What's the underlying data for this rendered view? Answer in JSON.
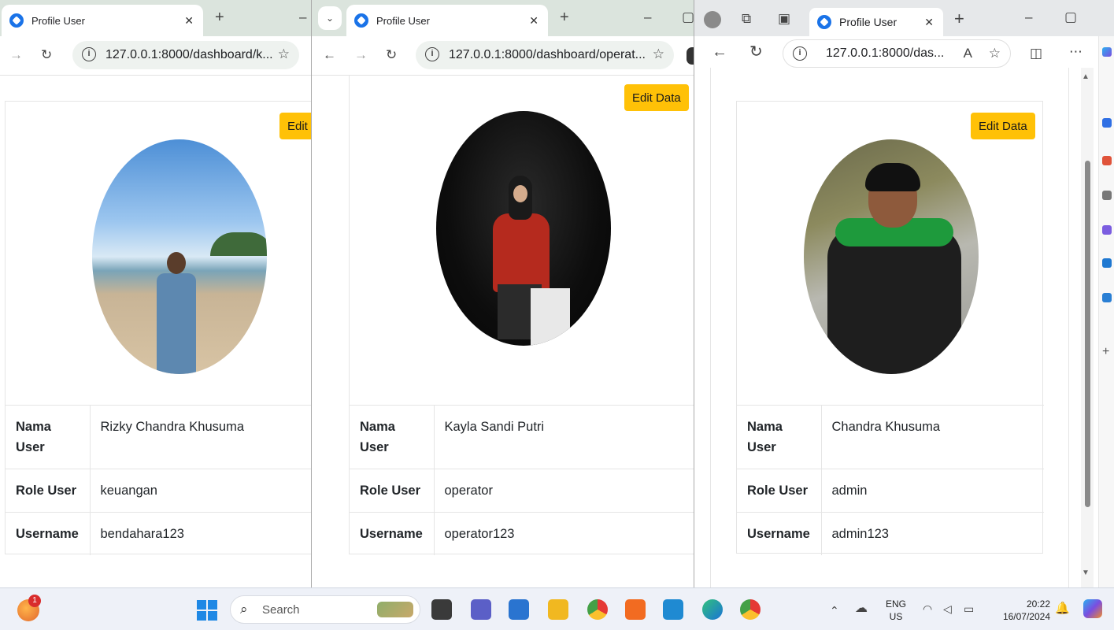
{
  "windows": [
    {
      "tab_title": "Profile User",
      "url": "127.0.0.1:8000/dashboard/k...",
      "edit_label": "Edit",
      "profile": {
        "name_label": "Nama User",
        "name": "Rizky Chandra Khusuma",
        "role_label": "Role User",
        "role": "keuangan",
        "username_label": "Username",
        "username": "bendahara123"
      }
    },
    {
      "tab_title": "Profile User",
      "url": "127.0.0.1:8000/dashboard/operat...",
      "edit_label": "Edit Data",
      "profile": {
        "name_label": "Nama User",
        "name": "Kayla Sandi Putri",
        "role_label": "Role User",
        "role": "operator",
        "username_label": "Username",
        "username": "operator123"
      }
    },
    {
      "tab_title": "Profile User",
      "url": "127.0.0.1:8000/das...",
      "edit_label": "Edit Data",
      "profile": {
        "name_label": "Nama User",
        "name": "Chandra Khusuma",
        "role_label": "Role User",
        "role": "admin",
        "username_label": "Username",
        "username": "admin123"
      }
    }
  ],
  "taskbar": {
    "search_placeholder": "Search",
    "notification_count": "1",
    "language_top": "ENG",
    "language_bottom": "US",
    "time": "20:22",
    "date": "16/07/2024",
    "colors": {
      "accent": "#ffc107",
      "chrome_tab_bg": "#dbe4dd"
    }
  }
}
